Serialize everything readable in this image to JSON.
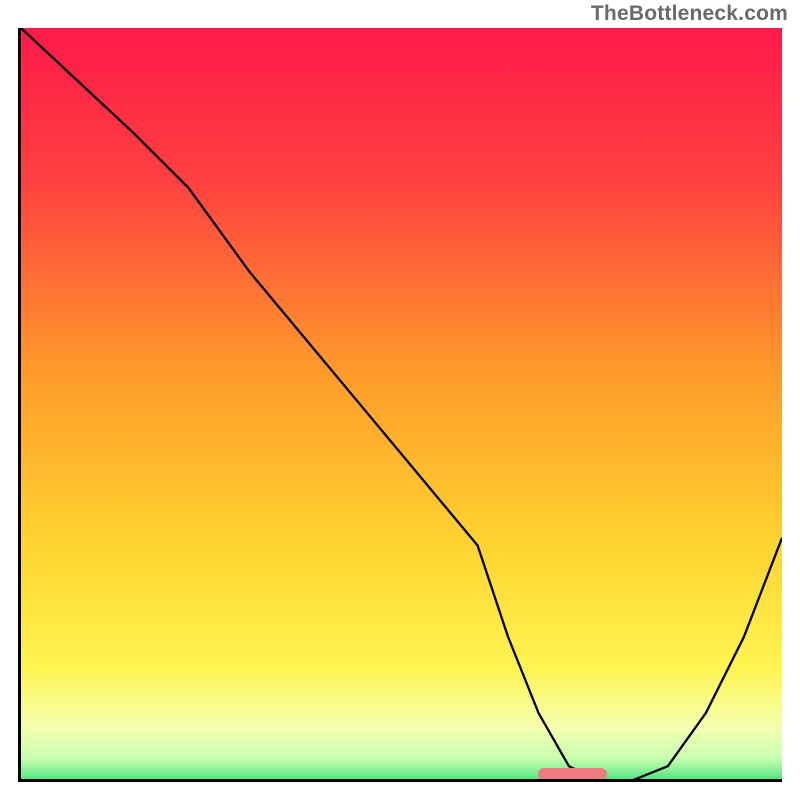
{
  "watermark": "TheBottleneck.com",
  "chart_data": {
    "type": "line",
    "title": "",
    "xlabel": "",
    "ylabel": "",
    "xlim": [
      0,
      100
    ],
    "ylim": [
      0,
      100
    ],
    "x": [
      0,
      15,
      22,
      30,
      40,
      50,
      60,
      64,
      68,
      72,
      76,
      80,
      85,
      90,
      95,
      100
    ],
    "values": [
      100,
      86,
      79,
      68,
      56,
      44,
      32,
      20,
      10,
      3,
      1,
      1,
      3,
      10,
      20,
      33
    ],
    "marker": {
      "x_start": 68,
      "x_end": 77,
      "y": 0.7
    },
    "bg_gradient": {
      "stops": [
        {
          "pct": 0,
          "color": "#ff1a4a"
        },
        {
          "pct": 20,
          "color": "#ff4040"
        },
        {
          "pct": 45,
          "color": "#ff9a2a"
        },
        {
          "pct": 68,
          "color": "#ffd430"
        },
        {
          "pct": 84,
          "color": "#fff450"
        },
        {
          "pct": 92,
          "color": "#f4ffb0"
        },
        {
          "pct": 96,
          "color": "#c8ffb0"
        },
        {
          "pct": 100,
          "color": "#1fd86a"
        }
      ]
    }
  },
  "colors": {
    "curve": "#000000",
    "marker": "#ee7b81",
    "axis": "#000000",
    "watermark": "#6a6a6a"
  }
}
